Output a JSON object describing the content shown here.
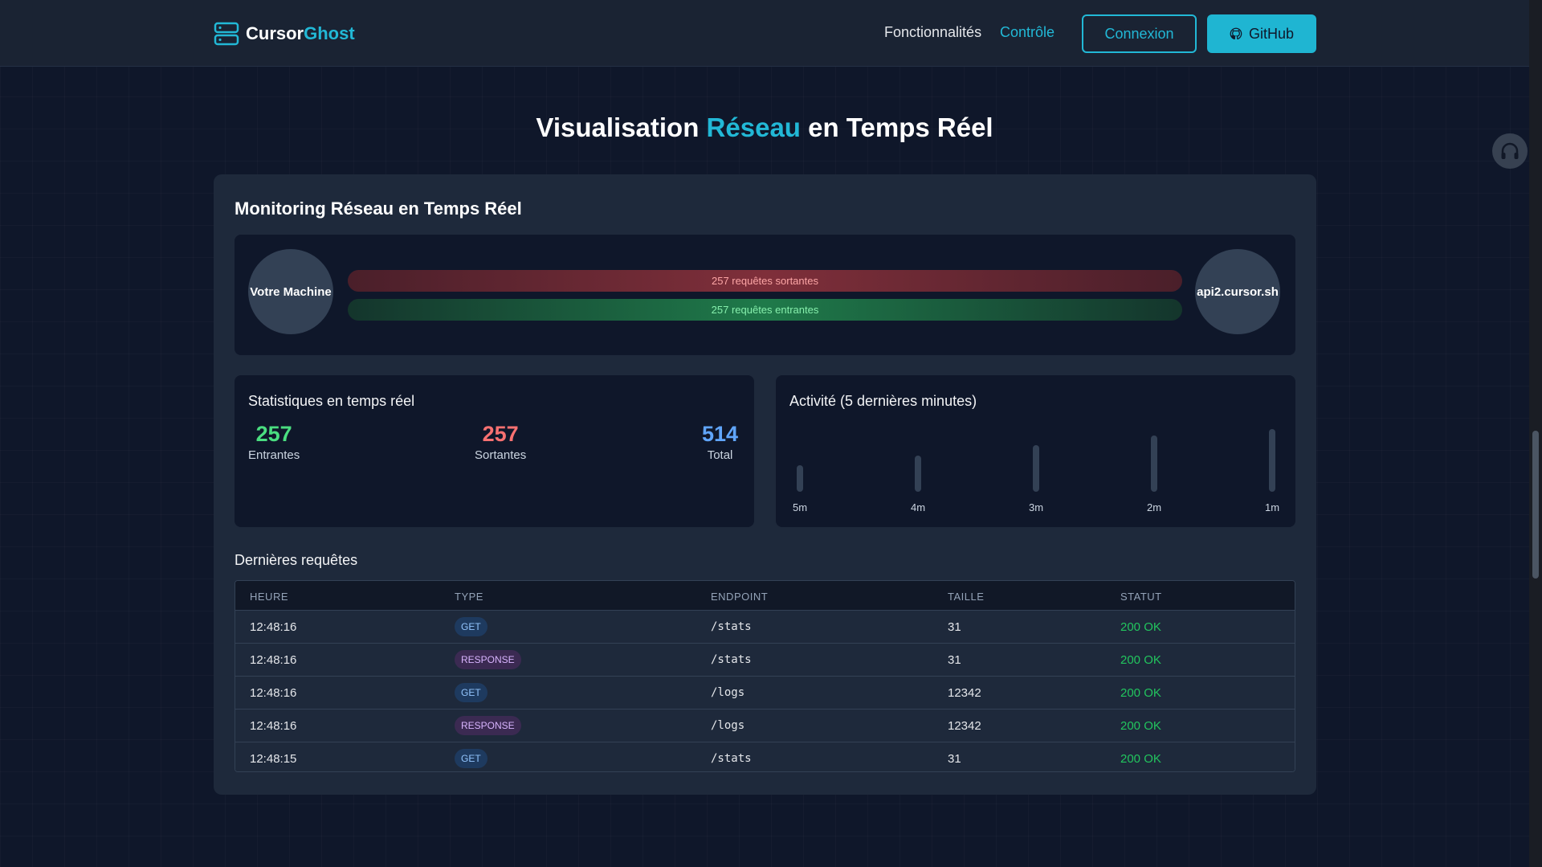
{
  "nav": {
    "brand_main": "Cursor",
    "brand_accent": "Ghost",
    "links": [
      "Fonctionnalités",
      "Contrôle"
    ],
    "login_label": "Connexion",
    "github_label": "GitHub"
  },
  "headline": {
    "part1": "Visualisation ",
    "accent": "Réseau",
    "part2": " en Temps Réel"
  },
  "card": {
    "title": "Monitoring Réseau en Temps Réel",
    "flow": {
      "source": "Votre Machine",
      "target": "api2.cursor.sh",
      "outgoing": "257 requêtes sortantes",
      "incoming": "257 requêtes entrantes"
    },
    "stats": {
      "title": "Statistiques en temps réel",
      "incoming_value": "257",
      "incoming_label": "Entrantes",
      "outgoing_value": "257",
      "outgoing_label": "Sortantes",
      "total_value": "514",
      "total_label": "Total"
    },
    "activity": {
      "title": "Activité (5 dernières minutes)",
      "labels": [
        "5m",
        "4m",
        "3m",
        "2m",
        "1m"
      ],
      "levels": [
        0.42,
        0.58,
        0.74,
        0.9,
        1.0
      ]
    },
    "table": {
      "title": "Dernières requêtes",
      "headers": [
        "HEURE",
        "TYPE",
        "ENDPOINT",
        "TAILLE",
        "STATUT"
      ],
      "rows": [
        [
          "12:48:16",
          "GET",
          "/stats",
          "31",
          "200 OK"
        ],
        [
          "12:48:16",
          "RESPONSE",
          "/stats",
          "31",
          "200 OK"
        ],
        [
          "12:48:16",
          "GET",
          "/logs",
          "12342",
          "200 OK"
        ],
        [
          "12:48:16",
          "RESPONSE",
          "/logs",
          "12342",
          "200 OK"
        ],
        [
          "12:48:15",
          "GET",
          "/stats",
          "31",
          "200 OK"
        ]
      ]
    }
  },
  "colors": {
    "accent": "#22b8d6",
    "incoming": "#4ade80",
    "outgoing": "#f87171",
    "total": "#60a5fa",
    "status_ok": "#22c55e"
  },
  "icons": {
    "brand": "server-icon",
    "github": "github-icon",
    "floating": "headphones-icon"
  }
}
